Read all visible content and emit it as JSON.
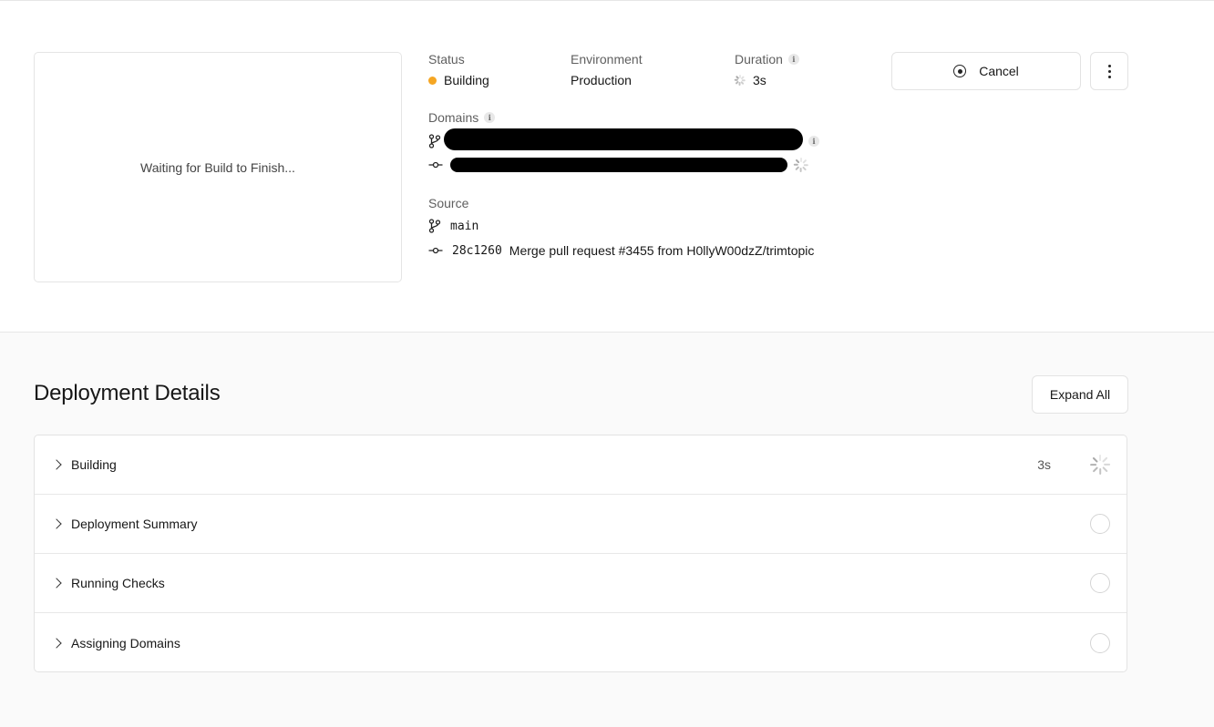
{
  "preview": {
    "text": "Waiting for Build to Finish..."
  },
  "status": {
    "label": "Status",
    "value": "Building",
    "color": "#f5a623"
  },
  "environment": {
    "label": "Environment",
    "value": "Production"
  },
  "duration": {
    "label": "Duration",
    "value": "3s"
  },
  "actions": {
    "cancel_label": "Cancel"
  },
  "domains": {
    "label": "Domains"
  },
  "source": {
    "label": "Source",
    "branch": "main",
    "commit_hash": "28c1260",
    "commit_message": "Merge pull request #3455 from H0llyW00dzZ/trimtopic"
  },
  "details": {
    "title": "Deployment Details",
    "expand_label": "Expand All",
    "steps": [
      {
        "label": "Building",
        "time": "3s",
        "state": "in-progress"
      },
      {
        "label": "Deployment Summary",
        "state": "pending"
      },
      {
        "label": "Running Checks",
        "state": "pending"
      },
      {
        "label": "Assigning Domains",
        "state": "pending"
      }
    ]
  }
}
